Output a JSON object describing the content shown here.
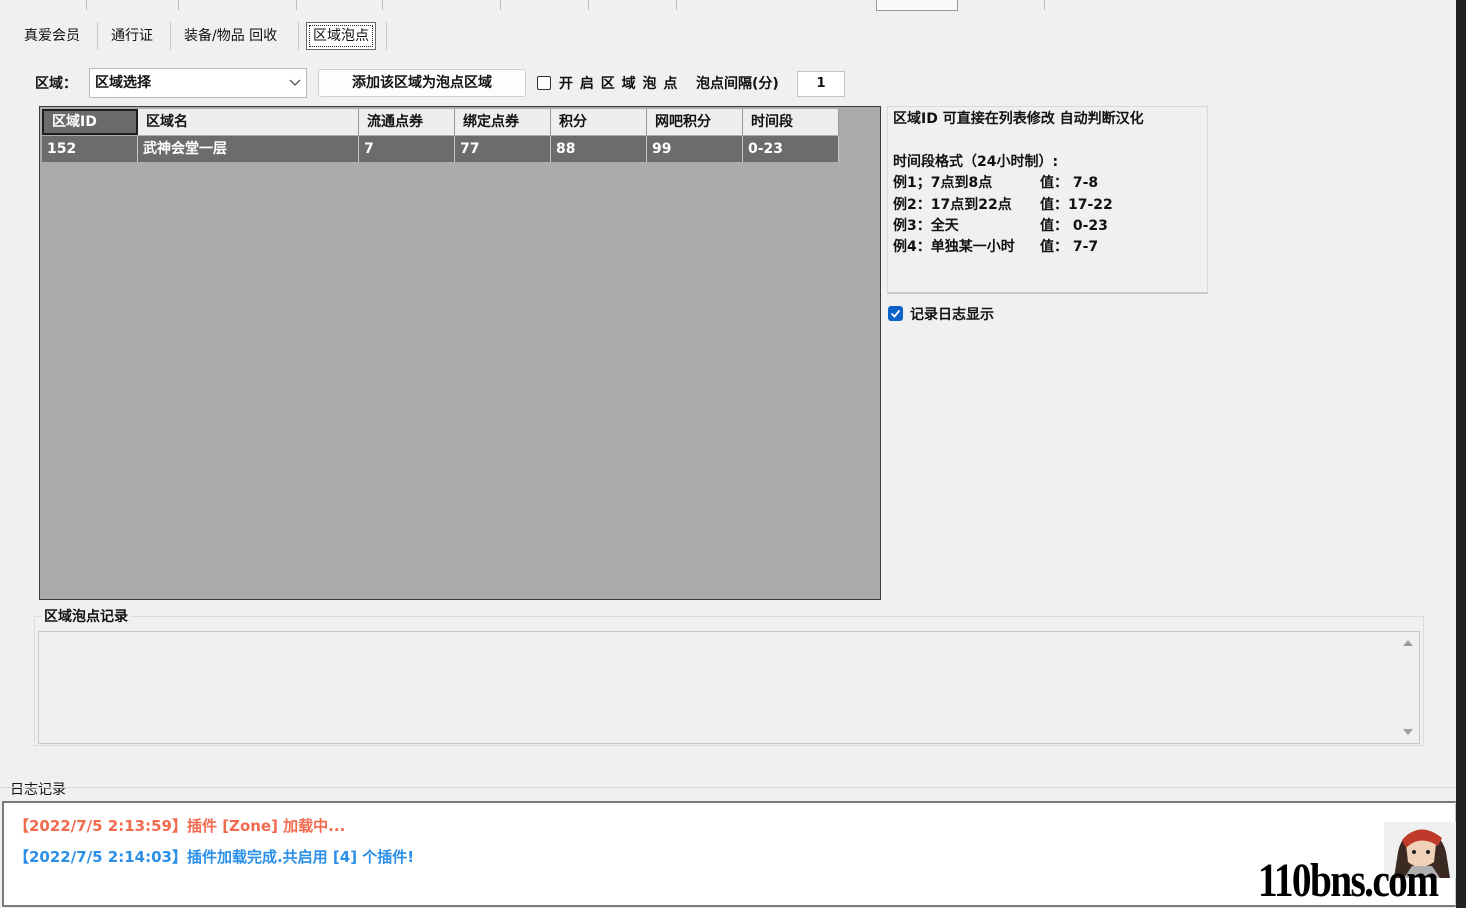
{
  "sub_tabs": [
    {
      "label": "真爱会员"
    },
    {
      "label": "通行证"
    },
    {
      "label": "装备/物品 回收"
    },
    {
      "label": "区域泡点",
      "active": true
    }
  ],
  "toolbar": {
    "zone_label": "区域：",
    "zone_select_value": "区域选择",
    "add_button_label": "添加该区域为泡点区域",
    "enable_label": "开 启 区 域 泡 点",
    "interval_label": "泡点间隔(分)",
    "interval_value": "1"
  },
  "table": {
    "columns": [
      "区域ID",
      "区域名",
      "流通点券",
      "绑定点券",
      "积分",
      "网吧积分",
      "时间段"
    ],
    "rows": [
      [
        "152",
        "武神会堂一层",
        "7",
        "77",
        "88",
        "99",
        "0-23"
      ]
    ]
  },
  "info": {
    "line1": "区域ID 可直接在列表修改 自动判断汉化",
    "format_title": "时间段格式（24小时制）:",
    "examples": [
      {
        "label": "例1；7点到8点",
        "value": "值： 7-8"
      },
      {
        "label": "例2：17点到22点",
        "value": "值：17-22"
      },
      {
        "label": "例3：全天",
        "value": "值： 0-23"
      },
      {
        "label": "例4：单独某一小时",
        "value": "值： 7-7"
      }
    ]
  },
  "log_display_checkbox": {
    "label": "记录日志显示",
    "checked": true
  },
  "zone_log": {
    "title": "区域泡点记录"
  },
  "log": {
    "title": "日志记录",
    "entries": [
      {
        "text": "【2022/7/5 2:13:59】插件 [Zone] 加载中...",
        "color": "#f26b4f"
      },
      {
        "text": "【2022/7/5 2:14:03】插件加载完成.共启用 [4] 个插件!",
        "color": "#2b8fe8"
      }
    ]
  },
  "watermark": "110bns.com",
  "colors": {
    "accent": "#0a64c8",
    "grid_bg": "#ababab",
    "row_bg": "#6c6c6c"
  }
}
